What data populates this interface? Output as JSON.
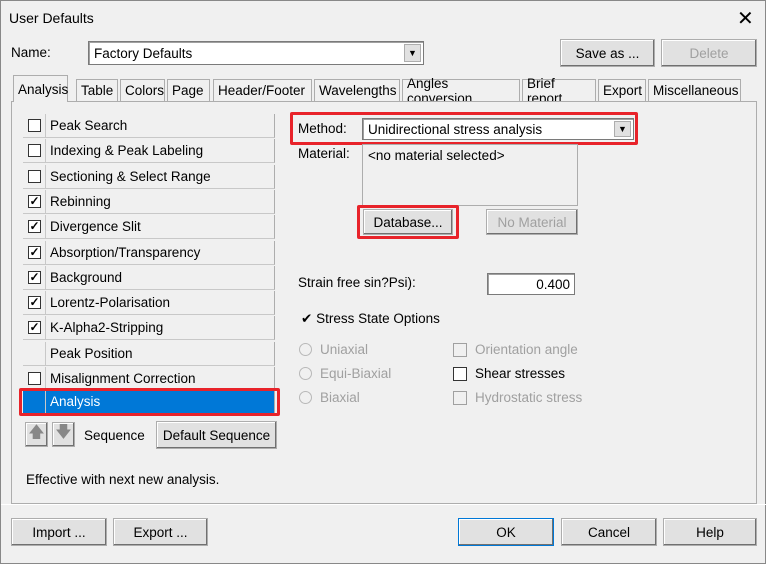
{
  "window": {
    "title": "User Defaults",
    "close_icon": "close-icon"
  },
  "name_row": {
    "label": "Name:",
    "value": "Factory Defaults",
    "save_as": "Save as ...",
    "delete": "Delete"
  },
  "tabs": [
    "Analysis",
    "Table",
    "Colors",
    "Page",
    "Header/Footer",
    "Wavelengths",
    "Angles conversion",
    "Brief report",
    "Export",
    "Miscellaneous"
  ],
  "steps": [
    {
      "label": "Peak Search",
      "checkbox": true,
      "checked": false
    },
    {
      "label": "Indexing & Peak Labeling",
      "checkbox": true,
      "checked": false
    },
    {
      "label": "Sectioning & Select Range",
      "checkbox": true,
      "checked": false
    },
    {
      "label": "Rebinning",
      "checkbox": true,
      "checked": true
    },
    {
      "label": "Divergence Slit",
      "checkbox": true,
      "checked": true
    },
    {
      "label": "Absorption/Transparency",
      "checkbox": true,
      "checked": true
    },
    {
      "label": "Background",
      "checkbox": true,
      "checked": true
    },
    {
      "label": "Lorentz-Polarisation",
      "checkbox": true,
      "checked": true
    },
    {
      "label": "K-Alpha2-Stripping",
      "checkbox": true,
      "checked": true
    },
    {
      "label": "Peak Position",
      "checkbox": false,
      "checked": false
    },
    {
      "label": "Misalignment Correction",
      "checkbox": true,
      "checked": false
    },
    {
      "label": "Analysis",
      "checkbox": false,
      "checked": false,
      "selected": true
    }
  ],
  "sequence": {
    "label": "Sequence",
    "default_button": "Default Sequence",
    "up_icon": "arrow-up-icon",
    "down_icon": "arrow-down-icon"
  },
  "note": "Effective with next new analysis.",
  "method": {
    "label": "Method:",
    "value": "Unidirectional stress analysis"
  },
  "material": {
    "label": "Material:",
    "value": "<no material selected>",
    "database_button": "Database...",
    "no_material_button": "No Material"
  },
  "strain": {
    "label": "Strain free sin?Psi):",
    "value": "0.400"
  },
  "stress_state": {
    "label": "Stress State Options",
    "radios": [
      {
        "label": "Uniaxial",
        "enabled": false
      },
      {
        "label": "Equi-Biaxial",
        "enabled": false
      },
      {
        "label": "Biaxial",
        "enabled": false
      }
    ],
    "checks": [
      {
        "label": "Orientation angle",
        "enabled": false,
        "checked": false
      },
      {
        "label": "Shear stresses",
        "enabled": true,
        "checked": false
      },
      {
        "label": "Hydrostatic stress",
        "enabled": false,
        "checked": false
      }
    ]
  },
  "footer": {
    "import": "Import ...",
    "export": "Export ...",
    "ok": "OK",
    "cancel": "Cancel",
    "help": "Help"
  },
  "colors": {
    "highlight": "#e8232a",
    "selection": "#0078d7"
  }
}
